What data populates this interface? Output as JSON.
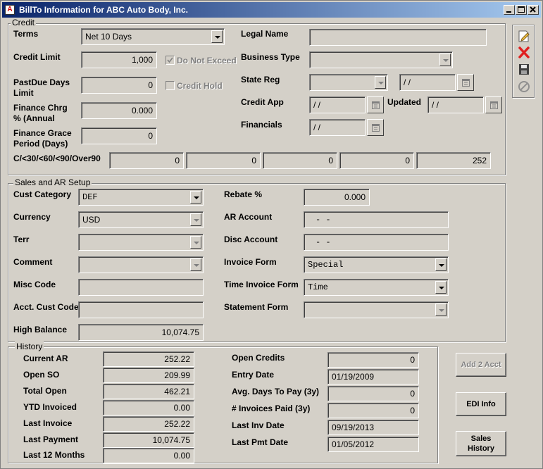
{
  "window": {
    "title": "BillTo Information for ABC Auto Body, Inc."
  },
  "credit": {
    "title": "Credit",
    "terms_label": "Terms",
    "terms_value": "Net 10 Days",
    "credit_limit_label": "Credit Limit",
    "credit_limit_value": "1,000",
    "do_not_exceed_label": "Do Not Exceed",
    "pastdue_label_1": "PastDue Days",
    "pastdue_label_2": "Limit",
    "pastdue_value": "0",
    "credit_hold_label": "Credit Hold",
    "finance_chrg_label_1": "Finance Chrg",
    "finance_chrg_label_2": "% (Annual",
    "finance_chrg_value": "0.000",
    "finance_grace_label_1": "Finance Grace",
    "finance_grace_label_2": "Period (Days)",
    "finance_grace_value": "0",
    "legal_name_label": "Legal Name",
    "legal_name_value": "",
    "business_type_label": "Business Type",
    "business_type_value": "",
    "state_reg_label": "State Reg",
    "state_reg_value": "",
    "state_reg_date": "/ /",
    "credit_app_label": "Credit App",
    "credit_app_date": "/ /",
    "updated_label": "Updated",
    "updated_date": "/ /",
    "financials_label": "Financials",
    "financials_date": "/ /",
    "aging_label": "C/<30/<60/<90/Over90",
    "aging_values": [
      "0",
      "0",
      "0",
      "0",
      "252"
    ]
  },
  "sales": {
    "title": "Sales and AR Setup",
    "cust_category_label": "Cust Category",
    "cust_category_value": "DEF",
    "currency_label": "Currency",
    "currency_value": "USD",
    "terr_label": "Terr",
    "terr_value": "",
    "comment_label": "Comment",
    "comment_value": "",
    "misc_code_label": "Misc Code",
    "misc_code_value": "",
    "acct_cust_code_label": "Acct. Cust Code",
    "acct_cust_code_value": "",
    "high_balance_label": "High Balance",
    "high_balance_value": "10,074.75",
    "rebate_label": "Rebate %",
    "rebate_value": "0.000",
    "ar_account_label": "AR Account",
    "ar_account_value": "- -",
    "disc_account_label": "Disc Account",
    "disc_account_value": "- -",
    "invoice_form_label": "Invoice Form",
    "invoice_form_value": "Special",
    "time_invoice_form_label": "Time Invoice Form",
    "time_invoice_form_value": "Time",
    "statement_form_label": "Statement Form",
    "statement_form_value": ""
  },
  "history": {
    "title": "History",
    "current_ar_label": "Current AR",
    "current_ar_value": "252.22",
    "open_so_label": "Open SO",
    "open_so_value": "209.99",
    "total_open_label": "Total Open",
    "total_open_value": "462.21",
    "ytd_invoiced_label": "YTD Invoiced",
    "ytd_invoiced_value": "0.00",
    "last_invoice_label": "Last Invoice",
    "last_invoice_value": "252.22",
    "last_payment_label": "Last Payment",
    "last_payment_value": "10,074.75",
    "last_12_label": "Last 12 Months",
    "last_12_value": "0.00",
    "open_credits_label": "Open Credits",
    "open_credits_value": "0",
    "entry_date_label": "Entry Date",
    "entry_date_value": "01/19/2009",
    "avg_days_label": "Avg. Days To Pay (3y)",
    "avg_days_value": "0",
    "invoices_paid_label": "# Invoices Paid (3y)",
    "invoices_paid_value": "0",
    "last_inv_date_label": "Last Inv Date",
    "last_inv_date_value": "09/19/2013",
    "last_pmt_date_label": "Last Pmt Date",
    "last_pmt_date_value": "01/05/2012"
  },
  "buttons": {
    "add_2_acct": "Add 2 Acct",
    "edi_info": "EDI Info",
    "sales_history_1": "Sales",
    "sales_history_2": "History"
  },
  "colors": {
    "title_start": "#0a246a",
    "title_end": "#a6caf0",
    "face": "#d4d0c8",
    "delete_red": "#e02020"
  }
}
